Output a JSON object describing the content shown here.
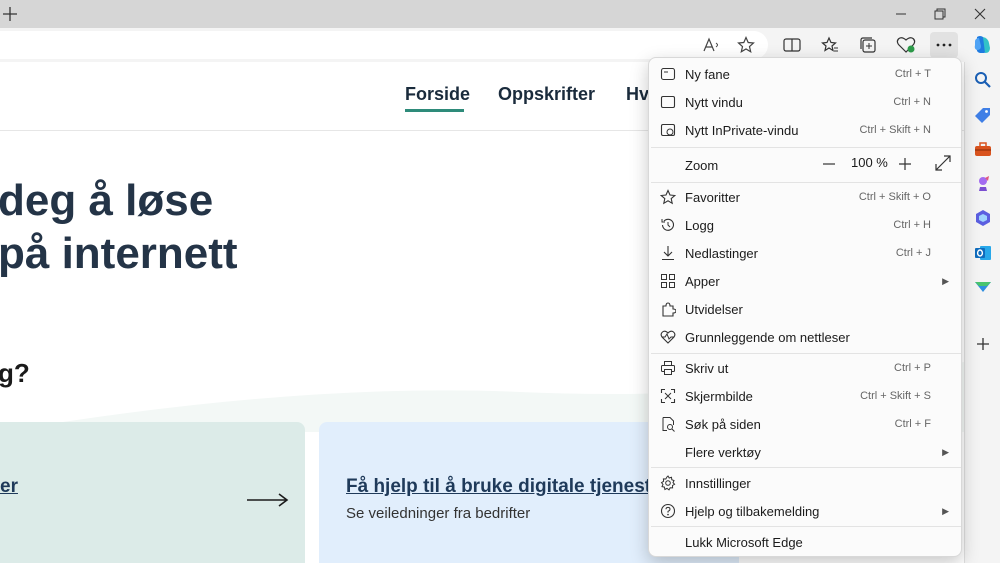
{
  "toolbar": {
    "new_tab_icon": "plus-icon",
    "read_aloud_icon": "read-aloud-icon",
    "favorite_icon": "star-icon",
    "split_screen_icon": "split-screen-icon",
    "favorites_icon": "favorites-icon",
    "collections_icon": "collections-icon",
    "browser_essentials_icon": "heart-pulse-icon",
    "more_icon": "more-icon",
    "copilot_icon": "copilot-icon"
  },
  "page": {
    "nav": [
      "Forside",
      "Oppskrifter",
      "Hv"
    ],
    "hero_line1": "deg å løse",
    "hero_line2": "på internett",
    "question": "g?",
    "card_left": "er",
    "card_title": "Få hjelp til å bruke digitale tjenester",
    "card_sub": "Se veiledninger fra bedrifter"
  },
  "menu": {
    "items": [
      {
        "label": "Ny fane",
        "shortcut": "Ctrl + T",
        "icon": "new-tab-icon"
      },
      {
        "label": "Nytt vindu",
        "shortcut": "Ctrl + N",
        "icon": "new-window-icon"
      },
      {
        "label": "Nytt InPrivate-vindu",
        "shortcut": "Ctrl + Skift + N",
        "icon": "inprivate-icon"
      },
      {
        "label": "Favoritter",
        "shortcut": "Ctrl + Skift + O",
        "icon": "favorites-icon"
      },
      {
        "label": "Logg",
        "shortcut": "Ctrl + H",
        "icon": "history-icon"
      },
      {
        "label": "Nedlastinger",
        "shortcut": "Ctrl + J",
        "icon": "download-icon"
      },
      {
        "label": "Apper",
        "shortcut": "",
        "icon": "apps-icon"
      },
      {
        "label": "Utvidelser",
        "shortcut": "",
        "icon": "extensions-icon"
      },
      {
        "label": "Grunnleggende om nettleser",
        "shortcut": "",
        "icon": "heart-pulse-icon"
      },
      {
        "label": "Skriv ut",
        "shortcut": "Ctrl + P",
        "icon": "print-icon"
      },
      {
        "label": "Skjermbilde",
        "shortcut": "Ctrl + Skift + S",
        "icon": "screenshot-icon"
      },
      {
        "label": "Søk på siden",
        "shortcut": "Ctrl + F",
        "icon": "find-icon"
      },
      {
        "label": "Flere verktøy",
        "shortcut": "",
        "icon": ""
      },
      {
        "label": "Innstillinger",
        "shortcut": "",
        "icon": "gear-icon"
      },
      {
        "label": "Hjelp og tilbakemelding",
        "shortcut": "",
        "icon": "help-icon"
      },
      {
        "label": "Lukk Microsoft Edge",
        "shortcut": "",
        "icon": ""
      }
    ],
    "zoom_label": "Zoom",
    "zoom_value": "100 %"
  },
  "colors": {
    "accent_underline": "#2e8b7a",
    "heading": "#243447",
    "link": "#1f3a5a"
  }
}
